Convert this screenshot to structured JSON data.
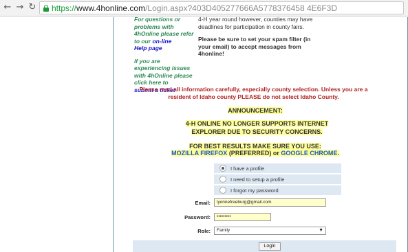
{
  "browser": {
    "url_scheme": "https://",
    "url_host": "www.4honline.com",
    "url_path": "/Login.aspx?403D405277666A5778376458 4E6F3D"
  },
  "help": {
    "line1": "For questions or problems with 4hOnline please refer to our",
    "online": "on-line",
    "helppage": "Help page",
    "line2": "If you are experiencing issues with 4hOnline please click here to",
    "ticket": "submit a ticket"
  },
  "notice": {
    "text1": "4-H year round however, counties may have deadlines for participation in county fairs.",
    "text2": "Please be sure to set your spam filter (in your email) to accept messages from 4honline!"
  },
  "warning": "Please read all information carefully, especially county selection. Unless you are a resident of Idaho county PLEASE do not select Idaho County.",
  "announcement": {
    "title": "ANNOUNCEMENT:",
    "ie": "4-H ONLINE NO LONGER SUPPORTS INTERNET EXPLORER DUE TO SECURITY CONCERNS.",
    "best": "FOR BEST RESULTS MAKE SURE YOU USE:",
    "firefox": "MOZILLA FIREFOX",
    "preferred": " (PREFERRED) or ",
    "chrome": "GOOGLE CHROME",
    "period": "."
  },
  "login_options": [
    {
      "label": "I have a profile",
      "selected": true
    },
    {
      "label": "I need to setup a profile",
      "selected": false
    },
    {
      "label": "I forgot my password",
      "selected": false
    }
  ],
  "form": {
    "email_label": "Email:",
    "email_value": "lyonnefreeburg@gmail.com",
    "password_label": "Password:",
    "password_value": "•••••••••",
    "role_label": "Role:",
    "role_value": "Family",
    "login_button": "Login"
  },
  "icons": {
    "back": "back-arrow-icon",
    "forward": "forward-arrow-icon",
    "reload": "reload-icon",
    "lock": "lock-icon",
    "dropdown": "chevron-down-icon"
  },
  "colors": {
    "help_text": "#2e8b57",
    "link_blue": "#1111cc",
    "warning_red": "#b22222",
    "highlight": "#ffff99",
    "form_band": "#dde8f3"
  }
}
